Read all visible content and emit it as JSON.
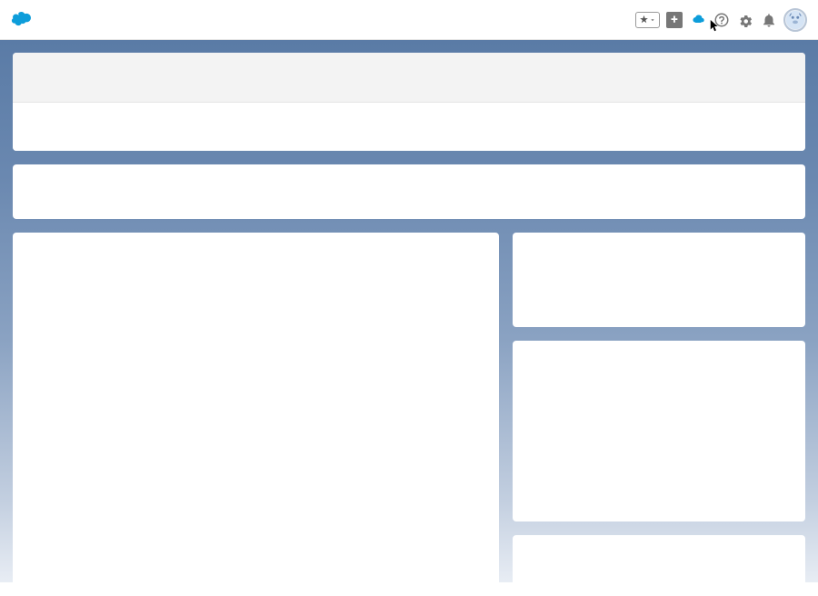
{
  "header": {
    "icons": {
      "logo": "salesforce-cloud",
      "favorites": "star",
      "add": "plus",
      "trailhead": "cloud-hover",
      "help": "question",
      "setup": "gear",
      "notifications": "bell",
      "avatar": "astro"
    }
  }
}
